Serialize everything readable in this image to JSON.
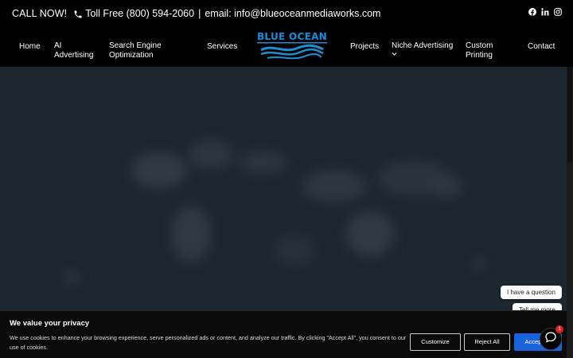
{
  "topbar": {
    "call_now": "CALL NOW!",
    "toll_free": "Toll Free (800) 594-2060",
    "separator": "|",
    "email": "email: info@blueoceanmediaworks.com",
    "socials": [
      "facebook-icon",
      "linkedin-icon",
      "instagram-icon"
    ]
  },
  "nav": {
    "items": [
      {
        "label": "Home"
      },
      {
        "label": "AI Advertising",
        "line1": "AI",
        "line2": "Advertising"
      },
      {
        "label": "Search Engine Optimization",
        "line1": "Search Engine",
        "line2": "Optimization"
      },
      {
        "label": "Services"
      },
      {
        "label": "Projects"
      },
      {
        "label": "Niche Advertising",
        "chevron": "chevron-down-icon"
      },
      {
        "label": "Custom Printing",
        "line1": "Custom",
        "line2": "Printing"
      },
      {
        "label": "Contact"
      }
    ],
    "logo_text": "BLUE OCEAN"
  },
  "chat": {
    "bubble1": "I have a question",
    "bubble2": "Tell me more",
    "badge_count": "1"
  },
  "cookie": {
    "title": "We value your privacy",
    "text": "We use cookies to enhance your browsing experience, serve personalized ads or content, and analyze our traffic. By clicking \"Accept All\", you consent to our use of cookies.",
    "customize": "Customize",
    "reject": "Reject All",
    "accept": "Accept All"
  },
  "colors": {
    "accent": "#1863dc",
    "hero_bg": "#1d2730",
    "logo_blue": "#1d8fd6"
  }
}
